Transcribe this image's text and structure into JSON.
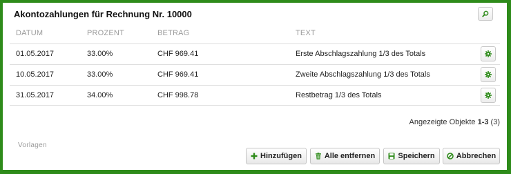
{
  "dialog": {
    "title": "Akontozahlungen für Rechnung Nr. 10000"
  },
  "table": {
    "columns": [
      "DATUM",
      "PROZENT",
      "BETRAG",
      "TEXT"
    ],
    "rows": [
      {
        "date": "01.05.2017",
        "percent": "33.00%",
        "amount": "CHF 969.41",
        "text": "Erste Abschlagszahlung 1/3 des Totals"
      },
      {
        "date": "10.05.2017",
        "percent": "33.00%",
        "amount": "CHF 969.41",
        "text": "Zweite Abschlagszahlung 1/3 des Totals"
      },
      {
        "date": "31.05.2017",
        "percent": "34.00%",
        "amount": "CHF 998.78",
        "text": "Restbetrag 1/3 des Totals"
      }
    ]
  },
  "footer": {
    "objects_label": "Angezeigte Objekte",
    "objects_range": "1-3",
    "objects_total": "(3)",
    "templates_label": "Vorlagen"
  },
  "buttons": {
    "add": "Hinzufügen",
    "remove_all": "Alle entfernen",
    "save": "Speichern",
    "cancel": "Abbrechen"
  },
  "icons": {
    "search": "search-icon",
    "row_settings": "gear-icon",
    "add": "plus-icon",
    "remove_all": "trash-icon",
    "save": "save-icon",
    "cancel": "cancel-icon"
  },
  "colors": {
    "frame": "#2e8b1a",
    "icon_green": "#2e8b1a"
  }
}
